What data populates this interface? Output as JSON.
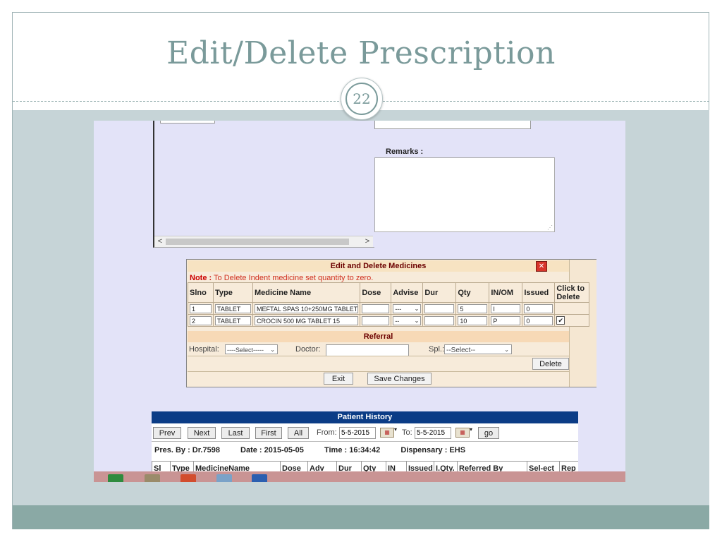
{
  "slide": {
    "title": "Edit/Delete Prescription",
    "page_number": "22"
  },
  "screenshot": {
    "remarks_label": "Remarks :",
    "edit_panel": {
      "title": "Edit and Delete Medicines",
      "close_symbol": "✕",
      "note_label": "Note :",
      "note_text": "To Delete Indent medicine set quantity to zero.",
      "columns": [
        "Slno",
        "Type",
        "Medicine Name",
        "Dose",
        "Advise",
        "Dur",
        "Qty",
        "IN/OM",
        "Issued",
        "Click to Delete"
      ],
      "rows": [
        {
          "slno": "1",
          "type": "TABLET",
          "medicine": "MEFTAL SPAS  10+250MG  TABLET",
          "dose": "",
          "advise": "---",
          "dur": "",
          "qty": "5",
          "in_om": "I",
          "issued": "0",
          "delete_checked": false
        },
        {
          "slno": "2",
          "type": "TABLET",
          "medicine": "CROCIN 500 MG TABLET 15",
          "dose": "",
          "advise": "--",
          "dur": "",
          "qty": "10",
          "in_om": "P",
          "issued": "0",
          "delete_checked": true
        }
      ],
      "referral_title": "Referral",
      "hospital_label": "Hospital:",
      "hospital_value": "----Select-----",
      "doctor_label": "Doctor:",
      "doctor_value": "",
      "spl_label": "Spl.:",
      "spl_value": "--Select--",
      "delete_button": "Delete",
      "exit_button": "Exit",
      "save_button": "Save Changes"
    },
    "patient_history": {
      "title": "Patient History",
      "nav_buttons": [
        "Prev",
        "Next",
        "Last",
        "First",
        "All"
      ],
      "from_label": "From:",
      "from_value": "5-5-2015",
      "to_label": "To:",
      "to_value": "5-5-2015",
      "go_button": "go",
      "pres_by": "Pres. By : Dr.7598",
      "date": "Date : 2015-05-05",
      "time": "Time : 16:34:42",
      "dispensary": "Dispensary : EHS",
      "columns": [
        "Sl",
        "Type",
        "MedicineName",
        "Dose",
        "Adv",
        "Dur",
        "Qty",
        "IN",
        "Issued",
        "I.Qty.",
        "Referred By",
        "Sel-ect",
        "Rep"
      ]
    }
  }
}
